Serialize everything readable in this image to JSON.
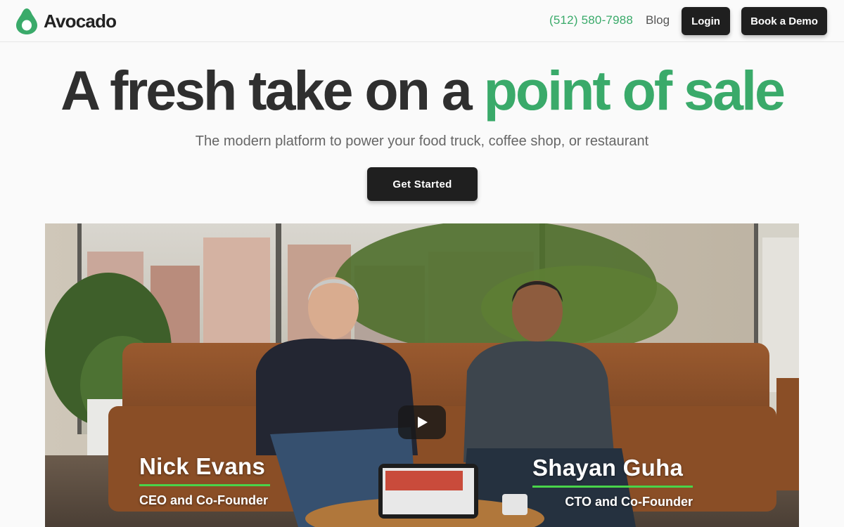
{
  "header": {
    "brand_name": "Avocado",
    "phone": "(512) 580-7988",
    "blog_label": "Blog",
    "login_label": "Login",
    "demo_label": "Book a Demo"
  },
  "hero": {
    "title_main": "A fresh take on a ",
    "title_accent": "point of sale",
    "subtitle": "The modern platform to power your food truck, coffee shop, or restaurant",
    "cta_label": "Get Started"
  },
  "video": {
    "person1": {
      "name": "Nick Evans",
      "role": "CEO and Co-Founder"
    },
    "person2": {
      "name": "Shayan Guha",
      "role": "CTO and Co-Founder"
    }
  },
  "colors": {
    "accent": "#3aaa6a",
    "button_dark": "#1f1f1f",
    "lower_third_bar": "#49d44a"
  },
  "icons": {
    "logo": "avocado-logo-icon",
    "play": "play-icon"
  }
}
